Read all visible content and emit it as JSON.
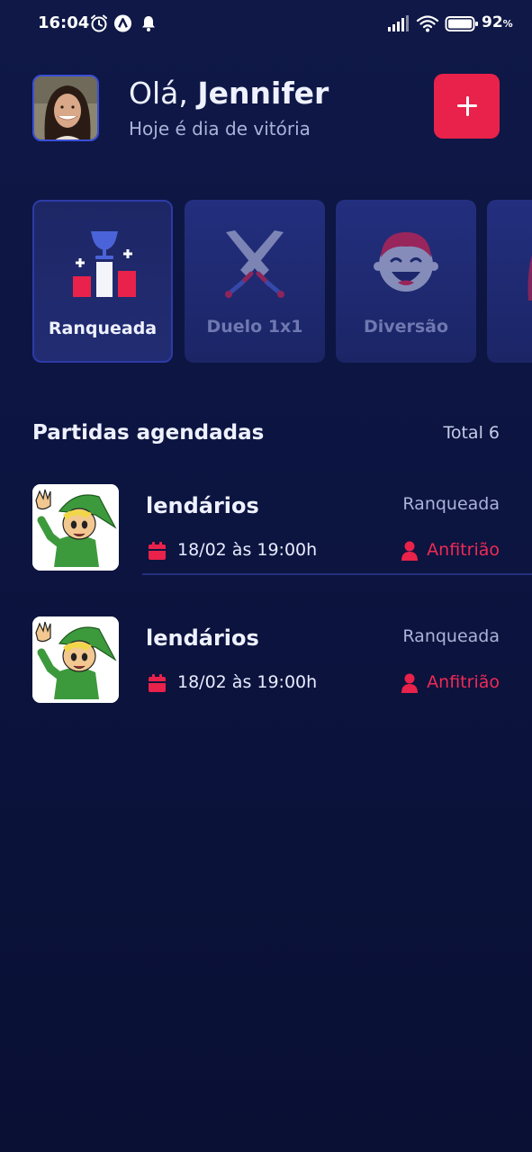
{
  "status_bar": {
    "time": "16:04",
    "battery_percent": "92",
    "battery_unit": "%",
    "icons": [
      "alarm-icon",
      "app-a-icon",
      "bell-icon",
      "signal-icon",
      "wifi-icon",
      "battery-icon"
    ]
  },
  "header": {
    "greeting": "Olá,",
    "user_name": "Jennifer",
    "subtitle": "Hoje é dia de vitória",
    "add_button_icon": "plus-icon"
  },
  "categories": [
    {
      "label": "Ranqueada",
      "icon": "trophy-podium-icon",
      "active": true
    },
    {
      "label": "Duelo 1x1",
      "icon": "crossed-swords-icon",
      "active": false
    },
    {
      "label": "Diversão",
      "icon": "laughing-face-icon",
      "active": false
    },
    {
      "label": "",
      "icon": "partial-card-icon",
      "active": false
    }
  ],
  "schedule": {
    "title": "Partidas agendadas",
    "total_label": "Total 6"
  },
  "matches": [
    {
      "name": "lendários",
      "type": "Ranqueada",
      "date": "18/02 às 19:00h",
      "role": "Anfitrião"
    },
    {
      "name": "lendários",
      "type": "Ranqueada",
      "date": "18/02 às 19:00h",
      "role": "Anfitrião"
    }
  ],
  "colors": {
    "background": "#0c1440",
    "accent": "#e8224a",
    "card": "#1f2a70",
    "text": "#eef1ff",
    "muted": "#aab3d8"
  }
}
